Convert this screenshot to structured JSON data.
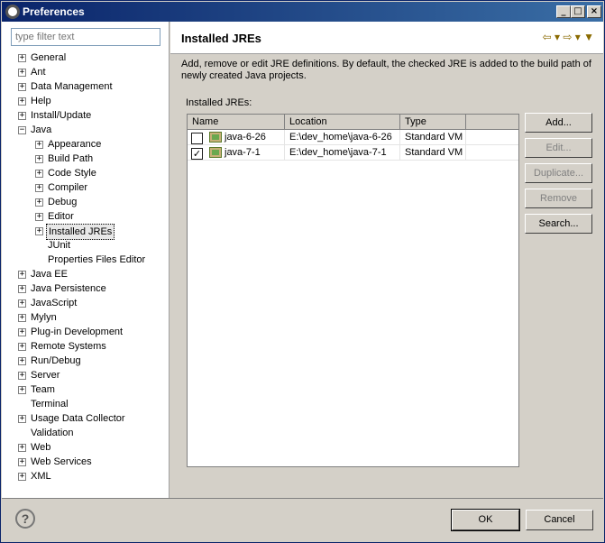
{
  "window": {
    "title": "Preferences",
    "minimize": "_",
    "maximize": "□",
    "close": "×"
  },
  "filter": {
    "placeholder": "type filter text"
  },
  "tree": [
    {
      "label": "General",
      "expander": "+",
      "level": 0
    },
    {
      "label": "Ant",
      "expander": "+",
      "level": 0
    },
    {
      "label": "Data Management",
      "expander": "+",
      "level": 0
    },
    {
      "label": "Help",
      "expander": "+",
      "level": 0
    },
    {
      "label": "Install/Update",
      "expander": "+",
      "level": 0
    },
    {
      "label": "Java",
      "expander": "−",
      "level": 0
    },
    {
      "label": "Appearance",
      "expander": "+",
      "level": 1
    },
    {
      "label": "Build Path",
      "expander": "+",
      "level": 1
    },
    {
      "label": "Code Style",
      "expander": "+",
      "level": 1
    },
    {
      "label": "Compiler",
      "expander": "+",
      "level": 1
    },
    {
      "label": "Debug",
      "expander": "+",
      "level": 1
    },
    {
      "label": "Editor",
      "expander": "+",
      "level": 1
    },
    {
      "label": "Installed JREs",
      "expander": "+",
      "level": 1,
      "selected": true
    },
    {
      "label": "JUnit",
      "expander": "",
      "level": 1
    },
    {
      "label": "Properties Files Editor",
      "expander": "",
      "level": 1
    },
    {
      "label": "Java EE",
      "expander": "+",
      "level": 0
    },
    {
      "label": "Java Persistence",
      "expander": "+",
      "level": 0
    },
    {
      "label": "JavaScript",
      "expander": "+",
      "level": 0
    },
    {
      "label": "Mylyn",
      "expander": "+",
      "level": 0
    },
    {
      "label": "Plug-in Development",
      "expander": "+",
      "level": 0
    },
    {
      "label": "Remote Systems",
      "expander": "+",
      "level": 0
    },
    {
      "label": "Run/Debug",
      "expander": "+",
      "level": 0
    },
    {
      "label": "Server",
      "expander": "+",
      "level": 0
    },
    {
      "label": "Team",
      "expander": "+",
      "level": 0
    },
    {
      "label": "Terminal",
      "expander": "",
      "level": 0
    },
    {
      "label": "Usage Data Collector",
      "expander": "+",
      "level": 0
    },
    {
      "label": "Validation",
      "expander": "",
      "level": 0
    },
    {
      "label": "Web",
      "expander": "+",
      "level": 0
    },
    {
      "label": "Web Services",
      "expander": "+",
      "level": 0
    },
    {
      "label": "XML",
      "expander": "+",
      "level": 0
    }
  ],
  "page": {
    "title": "Installed JREs",
    "nav": "⇦ ▾  ⇨ ▾  ▼",
    "description": "Add, remove or edit JRE definitions. By default, the checked JRE is added to the build path of newly created Java projects.",
    "section_label": "Installed JREs:"
  },
  "table": {
    "headers": [
      "Name",
      "Location",
      "Type"
    ],
    "rows": [
      {
        "checked": false,
        "check": "",
        "name": "java-6-26",
        "location": "E:\\dev_home\\java-6-26",
        "type": "Standard VM"
      },
      {
        "checked": true,
        "check": "✓",
        "name": "java-7-1",
        "location": "E:\\dev_home\\java-7-1",
        "type": "Standard VM"
      }
    ]
  },
  "buttons": {
    "add": "Add...",
    "edit": "Edit...",
    "duplicate": "Duplicate...",
    "remove": "Remove",
    "search": "Search...",
    "ok": "OK",
    "cancel": "Cancel",
    "help": "?"
  }
}
